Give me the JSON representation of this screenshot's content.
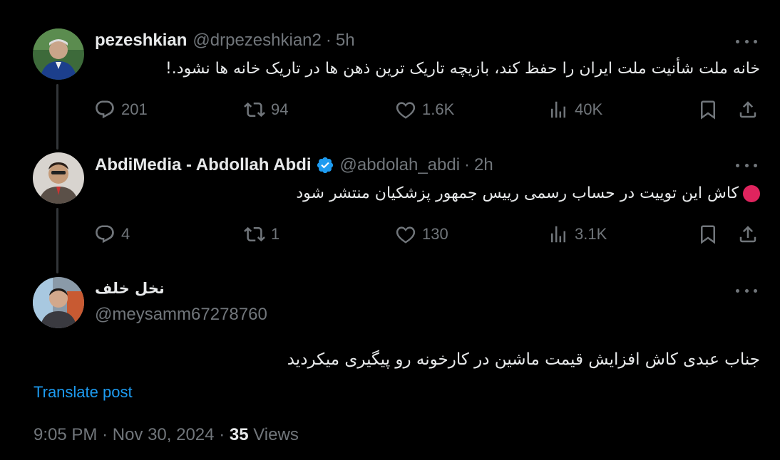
{
  "tweets": [
    {
      "display_name": "pezeshkian",
      "handle": "@drpezeshkian2",
      "separator": "·",
      "time": "5h",
      "text": "خانه ملت شأنیت ملت ایران را حفظ کند، بازیچه تاریک ترین ذهن ها در تاریک خانه ها نشود.!",
      "stats": {
        "replies": "201",
        "reposts": "94",
        "likes": "1.6K",
        "views": "40K"
      }
    },
    {
      "display_name": "AbdiMedia - Abdollah Abdi",
      "handle": "@abdolah_abdi",
      "separator": "·",
      "time": "2h",
      "verified": true,
      "text": "کاش این توییت در حساب رسمی رییس جمهور پزشکیان منتشر شود",
      "stats": {
        "replies": "4",
        "reposts": "1",
        "likes": "130",
        "views": "3.1K"
      }
    },
    {
      "display_name": "نخل خلف",
      "handle": "@meysamm67278760",
      "text": "جناب عبدی کاش افزایش قیمت ماشین در کارخونه رو پیگیری میکردید"
    }
  ],
  "translate_label": "Translate post",
  "meta": {
    "time": "9:05 PM",
    "date": "Nov 30, 2024",
    "separator": "·",
    "views_count": "35",
    "views_label": "Views"
  },
  "colors": {
    "accent": "#1d9bf0",
    "muted": "#71767b",
    "text": "#e7e9ea",
    "background": "#000000"
  }
}
